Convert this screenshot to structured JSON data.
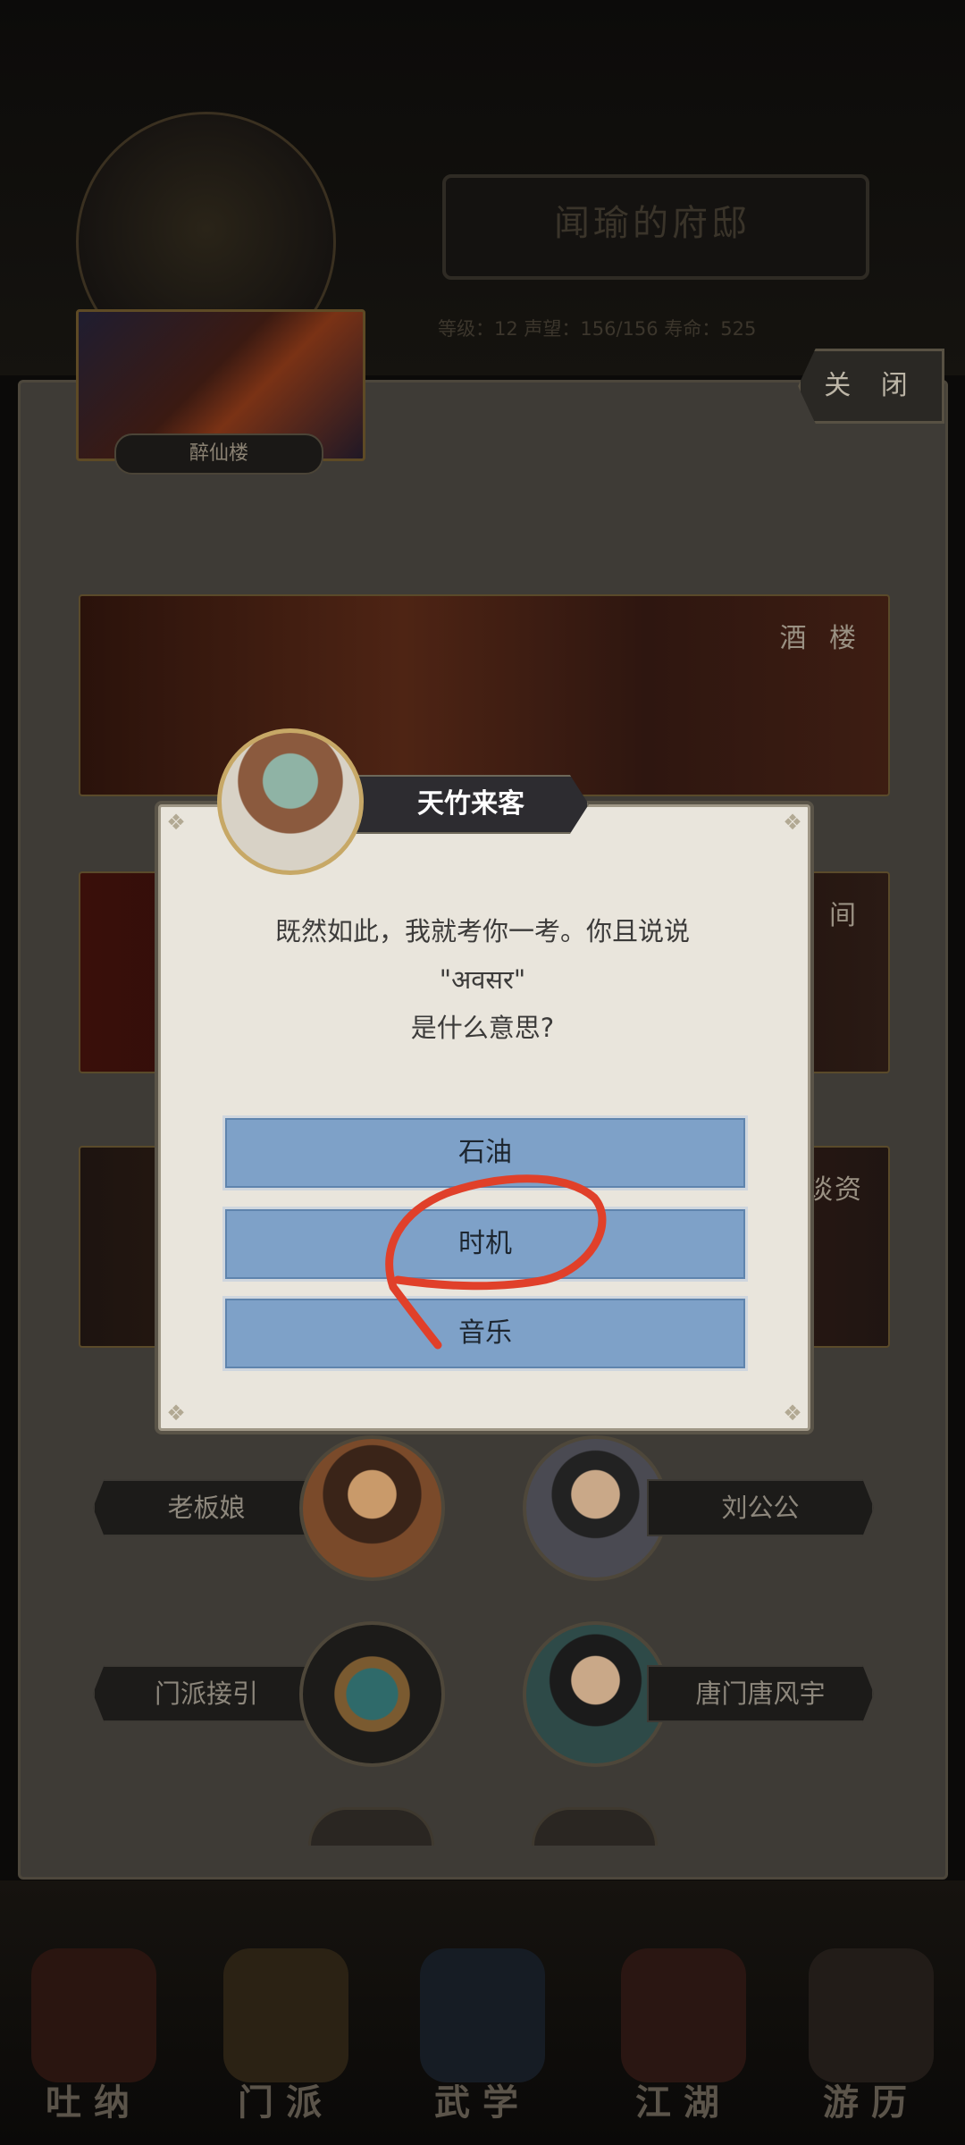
{
  "header": {
    "title": "闻瑜的府邸",
    "stats": "等级：12   声望：156/156   寿命：525"
  },
  "map": {
    "location_label": "醉仙楼"
  },
  "close_button": {
    "label": "关 闭"
  },
  "scenes": [
    {
      "label": "酒 楼"
    },
    {
      "label": "雅 间"
    },
    {
      "label": "谈资"
    }
  ],
  "npcs": [
    {
      "name": "老板娘"
    },
    {
      "name": "刘公公"
    },
    {
      "name": "门派接引"
    },
    {
      "name": "唐门唐风宇"
    }
  ],
  "dialog": {
    "speaker": "天竹来客",
    "question_line1": "既然如此，我就考你一考。你且说说",
    "question_line2": "\"अवसर\"",
    "question_line3": "是什么意思?",
    "options": [
      "石油",
      "时机",
      "音乐"
    ]
  },
  "bottom_nav": [
    {
      "label": "吐纳"
    },
    {
      "label": "门派"
    },
    {
      "label": "武学"
    },
    {
      "label": "江湖"
    },
    {
      "label": "游历"
    }
  ],
  "colors": {
    "option_bg": "#7ea1c8",
    "dialog_bg": "#e9e5dc",
    "annotation_stroke": "#e0402a",
    "speaker_plate": "#2d2c30"
  }
}
